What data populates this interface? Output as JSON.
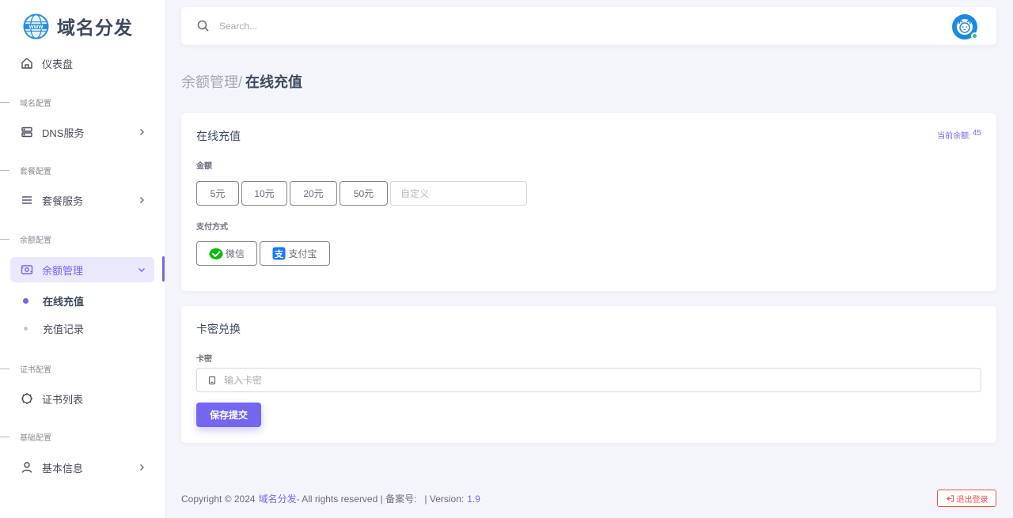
{
  "brand": {
    "name": "域名分发",
    "logo_icon": "www-globe-icon"
  },
  "sidebar": {
    "dashboard": {
      "label": "仪表盘",
      "icon": "home-icon"
    },
    "sections": [
      {
        "label": "域名配置"
      },
      {
        "label": "套餐配置"
      },
      {
        "label": "余额配置"
      },
      {
        "label": "证书配置"
      },
      {
        "label": "基础配置"
      }
    ],
    "items": [
      {
        "label": "DNS服务",
        "icon": "server-icon"
      },
      {
        "label": "套餐服务",
        "icon": "menu-icon"
      },
      {
        "label": "余额管理",
        "icon": "wallet-icon"
      },
      {
        "label": "证书列表",
        "icon": "certificate-icon"
      },
      {
        "label": "基本信息",
        "icon": "user-icon"
      }
    ],
    "sub_items": [
      {
        "label": "在线充值"
      },
      {
        "label": "充值记录"
      }
    ],
    "accent_color": "#7367f0"
  },
  "topbar": {
    "search_placeholder": "Search..."
  },
  "breadcrumb": {
    "parent": "余额管理/",
    "current": "在线充值"
  },
  "recharge": {
    "title": "在线充值",
    "balance_label": "当前余额:",
    "balance_value": "45",
    "amount_label": "金额",
    "amounts": [
      "5元",
      "10元",
      "20元",
      "50元"
    ],
    "custom_placeholder": "自定义",
    "payment_label": "支付方式",
    "payments": [
      {
        "label": "微信",
        "icon": "wechat-icon",
        "color": "#09bb07"
      },
      {
        "label": "支付宝",
        "icon": "alipay-icon",
        "color": "#1677ff"
      }
    ]
  },
  "redeem": {
    "title": "卡密兑换",
    "field_label": "卡密",
    "placeholder": "输入卡密",
    "submit_label": "保存提交"
  },
  "footer": {
    "copyright": "Copyright © 2024",
    "site_name": "域名分发",
    "rights": "- All rights reserved | 备案号:",
    "version_label": "| Version:",
    "version": "1.9"
  },
  "logout": {
    "label": "退出登录",
    "color": "#ea5455"
  }
}
